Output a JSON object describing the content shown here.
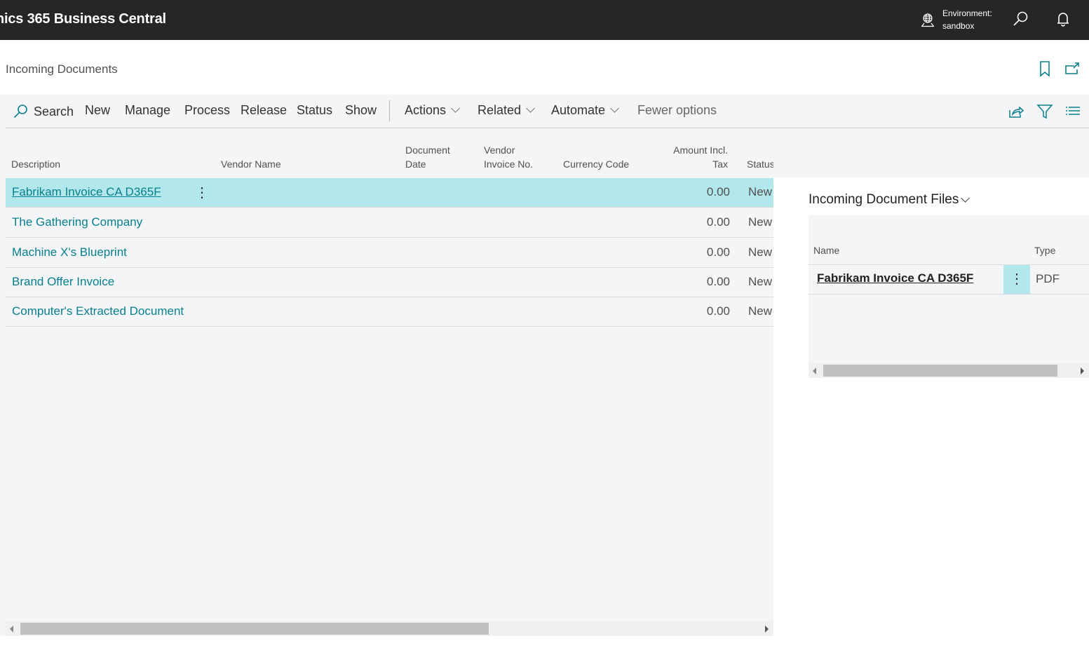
{
  "app": {
    "title": "nics 365 Business Central",
    "environment_label": "Environment:",
    "environment_value": "sandbox",
    "icons": [
      "globe-icon",
      "search-icon",
      "bell-icon"
    ]
  },
  "page": {
    "title": "Incoming Documents",
    "icons": [
      "bookmark-icon",
      "popout-icon"
    ]
  },
  "toolbar": {
    "search": "Search",
    "new": "New",
    "manage": "Manage",
    "process": "Process",
    "release": "Release",
    "status": "Status",
    "show": "Show",
    "actions": "Actions",
    "related": "Related",
    "automate": "Automate",
    "fewer_options": "Fewer options",
    "right_icons": [
      "share-icon",
      "filter-icon",
      "list-view-icon"
    ]
  },
  "table": {
    "columns": {
      "description": "Description",
      "vendor_name": "Vendor Name",
      "document_date_1": "Document",
      "document_date_2": "Date",
      "vendor_invoice_1": "Vendor",
      "vendor_invoice_2": "Invoice No.",
      "currency_code": "Currency Code",
      "amount_1": "Amount Incl.",
      "amount_2": "Tax",
      "status": "Status"
    },
    "rows": [
      {
        "description": "Fabrikam Invoice CA D365F",
        "amount": "0.00",
        "status": "New",
        "selected": true
      },
      {
        "description": "The Gathering Company",
        "amount": "0.00",
        "status": "New"
      },
      {
        "description": "Machine X's Blueprint",
        "amount": "0.00",
        "status": "New"
      },
      {
        "description": "Brand Offer Invoice",
        "amount": "0.00",
        "status": "New"
      },
      {
        "description": "Computer's Extracted Document",
        "amount": "0.00",
        "status": "New"
      }
    ]
  },
  "factbox": {
    "title": "Incoming Document Files",
    "col_name": "Name",
    "col_type": "Type",
    "rows": [
      {
        "name": "Fabrikam Invoice CA D365F",
        "type": "PDF"
      }
    ]
  },
  "colors": {
    "topbar": "#262626",
    "accent": "#087f8c",
    "selection": "#b2e8eb"
  }
}
